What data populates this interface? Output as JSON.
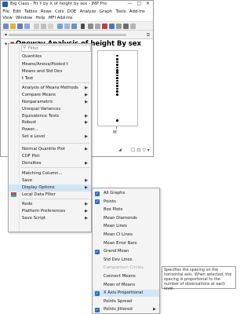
{
  "window": {
    "title": "Big Class - Fit Y by X of height by sex - JMP Pro",
    "menus_row1": [
      "File",
      "Edit",
      "Tables",
      "Rows",
      "Cols",
      "DOE",
      "Analyze",
      "Graph",
      "Tools",
      "Add-Ins"
    ],
    "menus_row2": [
      "View",
      "Window",
      "Help",
      "MFI Add-Ins"
    ],
    "controls": {
      "minimize": "—",
      "maximize": "□",
      "close": "✕"
    }
  },
  "report": {
    "title": "Oneway Analysis of height By sex",
    "plot": {
      "x_tick_label": "M",
      "points_normalized": [
        0.05,
        0.1,
        0.14,
        0.18,
        0.22,
        0.26,
        0.29,
        0.33,
        0.37,
        0.41,
        0.44,
        0.48,
        0.52,
        0.56,
        0.6,
        0.97
      ]
    }
  },
  "menu": {
    "filter_placeholder": "Filter",
    "items": [
      {
        "label": "Quantiles"
      },
      {
        "label": "Means/Anova/Pooled t"
      },
      {
        "label": "Means and Std Dev"
      },
      {
        "label": "t Test"
      },
      {
        "label": "Analysis of Means Methods",
        "submenu": true
      },
      {
        "label": "Compare Means",
        "submenu": true
      },
      {
        "label": "Nonparametric",
        "submenu": true
      },
      {
        "label": "Unequal Variances"
      },
      {
        "label": "Equivalence Tests",
        "submenu": true
      },
      {
        "label": "Robust",
        "submenu": true
      },
      {
        "label": "Power..."
      },
      {
        "label": "Set α Level",
        "submenu": true
      },
      {
        "label": "Normal Quantile Plot",
        "submenu": true
      },
      {
        "label": "CDF Plot"
      },
      {
        "label": "Densities",
        "submenu": true
      },
      {
        "label": "Matching Column..."
      },
      {
        "label": "Save",
        "submenu": true
      },
      {
        "label": "Display Options",
        "submenu": true,
        "highlighted": true
      },
      {
        "label": "Local Data Filter"
      },
      {
        "label": "Redo",
        "submenu": true
      },
      {
        "label": "Platform Preferences",
        "submenu": true
      },
      {
        "label": "Save Script",
        "submenu": true
      }
    ]
  },
  "display_options": {
    "items": [
      {
        "label": "All Graphs",
        "checked": true
      },
      {
        "label": "Points",
        "checked": true
      },
      {
        "label": "Box Plots",
        "checked": false
      },
      {
        "label": "Mean Diamonds",
        "checked": false
      },
      {
        "label": "Mean Lines",
        "checked": false
      },
      {
        "label": "Mean CI Lines",
        "checked": false
      },
      {
        "label": "Mean Error Bars",
        "checked": false
      },
      {
        "label": "Grand Mean",
        "checked": true
      },
      {
        "label": "Std Dev Lines",
        "checked": false
      },
      {
        "label": "Comparison Circles",
        "checked": false,
        "disabled": true
      },
      {
        "label": "Connect Means",
        "checked": false
      },
      {
        "label": "Mean of Means",
        "checked": false
      },
      {
        "label": "X Axis Proportional",
        "checked": true,
        "highlighted": true
      },
      {
        "label": "Points Spread",
        "checked": false
      },
      {
        "label": "Points Jittered",
        "checked": true,
        "submenu": true
      }
    ]
  },
  "tooltip": {
    "text": "Specifies the spacing on the horizontal axis. When selected, the spacing is proportional to the number of observations at each level."
  },
  "colors": {
    "accent": "#2b6cc4",
    "highlight": "#d3e6f8",
    "title_triangle": "#c00000"
  }
}
